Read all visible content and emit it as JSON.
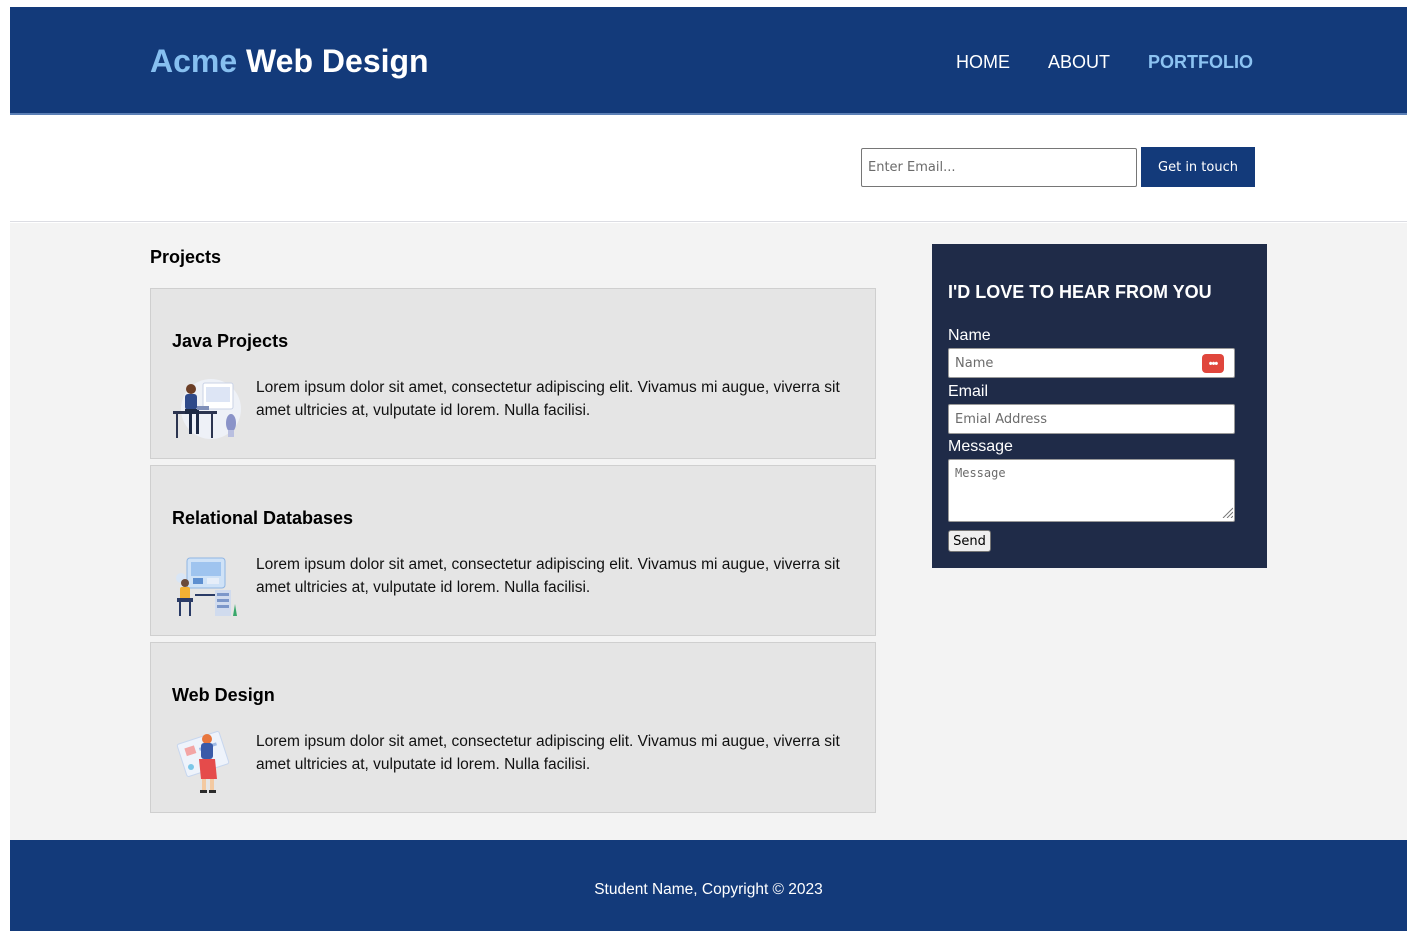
{
  "header": {
    "brand_highlight": "Acme",
    "brand_rest": "Web Design",
    "nav": [
      {
        "label": "HOME"
      },
      {
        "label": "ABOUT"
      },
      {
        "label": "PORTFOLIO",
        "active": true
      }
    ]
  },
  "subscribe": {
    "email_placeholder": "Enter Email...",
    "button_label": "Get in touch"
  },
  "main": {
    "section_title": "Projects",
    "projects": [
      {
        "title": "Java Projects",
        "text": "Lorem ipsum dolor sit amet, consectetur adipiscing elit. Vivamus mi augue, viverra sit amet ultricies at, vulputate id lorem. Nulla facilisi.",
        "icon": "developer-at-desk-illustration"
      },
      {
        "title": "Relational Databases",
        "text": "Lorem ipsum dolor sit amet, consectetur adipiscing elit. Vivamus mi augue, viverra sit amet ultricies at, vulputate id lorem. Nulla facilisi.",
        "icon": "database-workstation-illustration"
      },
      {
        "title": "Web Design",
        "text": "Lorem ipsum dolor sit amet, consectetur adipiscing elit. Vivamus mi augue, viverra sit amet ultricies at, vulputate id lorem. Nulla facilisi.",
        "icon": "designer-with-canvas-illustration"
      }
    ]
  },
  "sidebar": {
    "title": "I'd love to hear from you",
    "name_label": "Name",
    "name_placeholder": "Name",
    "email_label": "Email",
    "email_placeholder": "Emial Address",
    "message_label": "Message",
    "message_placeholder": "Message",
    "send_label": "Send"
  },
  "footer": {
    "text": "Student Name, Copyright © 2023"
  },
  "colors": {
    "primary": "#133a7a",
    "accent": "#86bff0",
    "sidebar_bg": "#1f2b48",
    "card_bg": "#e5e5e5",
    "main_bg": "#f3f3f3"
  }
}
